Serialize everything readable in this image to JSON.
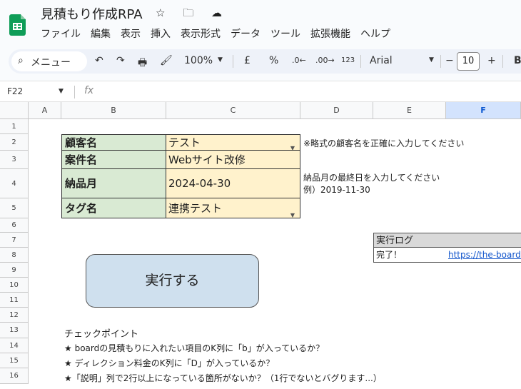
{
  "app": {
    "title": "見積もり作成RPA",
    "icons": "☆ 🗀 ☁"
  },
  "menu": [
    "ファイル",
    "編集",
    "表示",
    "挿入",
    "表示形式",
    "データ",
    "ツール",
    "拡張機能",
    "ヘルプ"
  ],
  "toolbar": {
    "search_label": "メニュー",
    "undo": "↶",
    "redo": "↷",
    "print": "🖶",
    "paint": "🖌",
    "zoom": "100%",
    "currency": "£",
    "percent": "%",
    "dec_less": ".0←",
    "dec_more": ".00→",
    "number_format": "123",
    "font": "Arial",
    "minus": "−",
    "font_size": "10",
    "plus": "+",
    "bold": "B"
  },
  "formula": {
    "cell": "F22",
    "fx": "fx",
    "value": ""
  },
  "columns": [
    "A",
    "B",
    "C",
    "D",
    "E",
    "F"
  ],
  "rows": [
    "1",
    "2",
    "3",
    "4",
    "5",
    "6",
    "7",
    "8",
    "9",
    "10",
    "11",
    "12",
    "13",
    "14",
    "15",
    "16"
  ],
  "form": [
    {
      "label": "顧客名",
      "value": "テスト",
      "dropdown": true
    },
    {
      "label": "案件名",
      "value": "Webサイト改修",
      "dropdown": false
    },
    {
      "label": "納品月",
      "value": "2024-04-30",
      "dropdown": false
    },
    {
      "label": "タグ名",
      "value": "連携テスト",
      "dropdown": true
    }
  ],
  "notes": {
    "customer": "※略式の顧客名を正確に入力してください",
    "delivery_1": "納品月の最終日を入力してください",
    "delivery_2": "例）2019-11-30"
  },
  "log": {
    "header": "実行ログ",
    "status": "完了！",
    "url": "https://the-board."
  },
  "button": {
    "label": "実行する"
  },
  "checkpoints": {
    "title": "チェックポイント",
    "items": [
      "★ boardの見積もりに入れたい項目のK列に「b」が入っているか？",
      "★ ディレクション料金のK列に「D」が入っているか？",
      "★「説明」列で2行以上になっている箇所がないか？（1行でないとバグります...）"
    ]
  }
}
